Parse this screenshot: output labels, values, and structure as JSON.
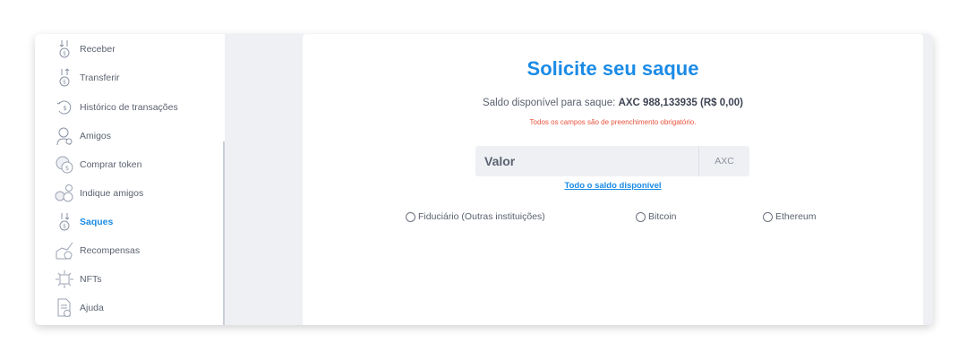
{
  "sidebar": {
    "items": [
      {
        "label": "Receber",
        "icon": "receive-coin-icon",
        "active": false
      },
      {
        "label": "Transferir",
        "icon": "transfer-coin-icon",
        "active": false
      },
      {
        "label": "Histórico de transações",
        "icon": "history-coin-icon",
        "active": false
      },
      {
        "label": "Amigos",
        "icon": "friends-icon",
        "active": false
      },
      {
        "label": "Comprar token",
        "icon": "buy-token-icon",
        "active": false
      },
      {
        "label": "Indique amigos",
        "icon": "refer-friends-icon",
        "active": false
      },
      {
        "label": "Saques",
        "icon": "withdraw-icon",
        "active": true
      },
      {
        "label": "Recompensas",
        "icon": "rewards-icon",
        "active": false
      },
      {
        "label": "NFTs",
        "icon": "nft-icon",
        "active": false
      },
      {
        "label": "Ajuda",
        "icon": "help-document-icon",
        "active": false
      }
    ]
  },
  "main": {
    "title": "Solicite seu saque",
    "balance_prefix": "Saldo disponível para saque:",
    "balance_value": "AXC 988,133935 (R$ 0,00)",
    "required_notice": "Todos os campos são de preenchimento obrigatório.",
    "amount_placeholder": "Valor",
    "amount_unit": "AXC",
    "all_balance_link": "Todo o saldo disponível",
    "methods": [
      "Fiduciário (Outras instituições)",
      "Bitcoin",
      "Ethereum"
    ]
  },
  "colors": {
    "accent": "#1b8be6",
    "required": "#e5533d",
    "text": "#5b6270",
    "background": "#eef0f4"
  }
}
